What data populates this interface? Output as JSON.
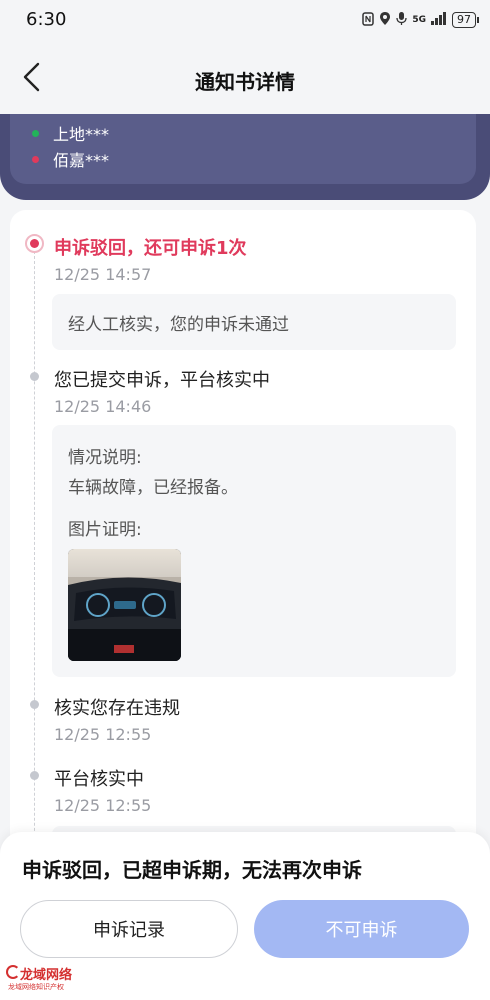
{
  "status": {
    "time": "6:30",
    "network": "5G",
    "battery": "97"
  },
  "nav": {
    "title": "通知书详情"
  },
  "parties": [
    {
      "name": "上地***",
      "color": "#23b35a"
    },
    {
      "name": "佰嘉***",
      "color": "#e03a5c"
    }
  ],
  "timeline": [
    {
      "title": "申诉驳回，还可申诉1次",
      "time": "12/25 14:57",
      "detail": "经人工核实，您的申诉未通过",
      "active": true
    },
    {
      "title": "您已提交申诉，平台核实中",
      "time": "12/25 14:46",
      "situation_label": "情况说明:",
      "situation_text": "车辆故障，已经报备。",
      "photo_label": "图片证明:"
    },
    {
      "title": "核实您存在违规",
      "time": "12/25 12:55"
    },
    {
      "title": "平台核实中",
      "time": "12/25 12:55"
    }
  ],
  "sheet": {
    "message": "申诉驳回，已超申诉期，无法再次申诉",
    "records_button": "申诉记录",
    "disabled_button": "不可申诉"
  },
  "watermark": {
    "name": "龙域网络",
    "sub": "龙域网络知识产权"
  },
  "colors": {
    "accent_red": "#e03a5c",
    "dark_card": "#4a4c77",
    "disabled_blue": "#a3b8f3"
  }
}
